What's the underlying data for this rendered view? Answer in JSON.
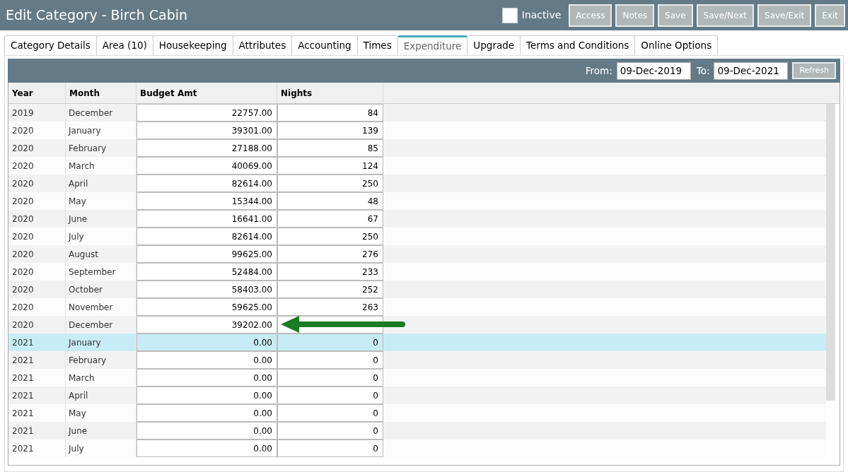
{
  "window": {
    "title": "Edit Category - Birch Cabin"
  },
  "inactive": {
    "label": "Inactive",
    "checked": false
  },
  "buttons": [
    "Access",
    "Notes",
    "Save",
    "Save/Next",
    "Save/Exit",
    "Exit"
  ],
  "tabs": [
    {
      "label": "Category Details",
      "selected": false
    },
    {
      "label": "Area (10)",
      "selected": false
    },
    {
      "label": "Housekeeping",
      "selected": false
    },
    {
      "label": "Attributes",
      "selected": false
    },
    {
      "label": "Accounting",
      "selected": false
    },
    {
      "label": "Times",
      "selected": false
    },
    {
      "label": "Expenditure",
      "selected": true
    },
    {
      "label": "Upgrade",
      "selected": false
    },
    {
      "label": "Terms and Conditions",
      "selected": false
    },
    {
      "label": "Online Options",
      "selected": false
    }
  ],
  "filter": {
    "from_label": "From:",
    "from": "09-Dec-2019",
    "to_label": "To:",
    "to": "09-Dec-2021",
    "refresh": "Refresh"
  },
  "table": {
    "columns": [
      "Year",
      "Month",
      "Budget Amt",
      "Nights"
    ],
    "rows": [
      {
        "year": "2019",
        "month": "December",
        "budget": "22757.00",
        "nights": "84",
        "selected": false
      },
      {
        "year": "2020",
        "month": "January",
        "budget": "39301.00",
        "nights": "139",
        "selected": false
      },
      {
        "year": "2020",
        "month": "February",
        "budget": "27188.00",
        "nights": "85",
        "selected": false
      },
      {
        "year": "2020",
        "month": "March",
        "budget": "40069.00",
        "nights": "124",
        "selected": false
      },
      {
        "year": "2020",
        "month": "April",
        "budget": "82614.00",
        "nights": "250",
        "selected": false
      },
      {
        "year": "2020",
        "month": "May",
        "budget": "15344.00",
        "nights": "48",
        "selected": false
      },
      {
        "year": "2020",
        "month": "June",
        "budget": "16641.00",
        "nights": "67",
        "selected": false
      },
      {
        "year": "2020",
        "month": "July",
        "budget": "82614.00",
        "nights": "250",
        "selected": false
      },
      {
        "year": "2020",
        "month": "August",
        "budget": "99625.00",
        "nights": "276",
        "selected": false
      },
      {
        "year": "2020",
        "month": "September",
        "budget": "52484.00",
        "nights": "233",
        "selected": false
      },
      {
        "year": "2020",
        "month": "October",
        "budget": "58403.00",
        "nights": "252",
        "selected": false
      },
      {
        "year": "2020",
        "month": "November",
        "budget": "59625.00",
        "nights": "263",
        "selected": false
      },
      {
        "year": "2020",
        "month": "December",
        "budget": "39202.00",
        "selected": false
      },
      {
        "year": "2021",
        "month": "January",
        "budget": "0.00",
        "nights": "0",
        "selected": true
      },
      {
        "year": "2021",
        "month": "February",
        "budget": "0.00",
        "nights": "0",
        "selected": false
      },
      {
        "year": "2021",
        "month": "March",
        "budget": "0.00",
        "nights": "0",
        "selected": false
      },
      {
        "year": "2021",
        "month": "April",
        "budget": "0.00",
        "nights": "0",
        "selected": false
      },
      {
        "year": "2021",
        "month": "May",
        "budget": "0.00",
        "nights": "0",
        "selected": false
      },
      {
        "year": "2021",
        "month": "June",
        "budget": "0.00",
        "nights": "0",
        "selected": false
      },
      {
        "year": "2021",
        "month": "July",
        "budget": "0.00",
        "nights": "0",
        "selected": false
      }
    ]
  }
}
